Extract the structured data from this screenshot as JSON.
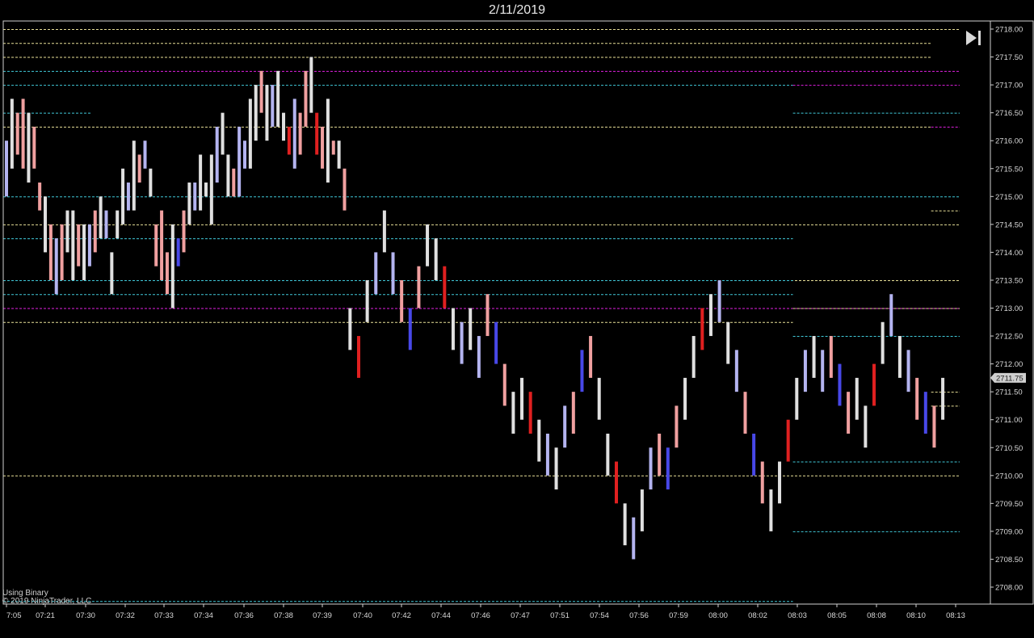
{
  "title": "2/11/2019",
  "footer": {
    "line1": "Using Binary",
    "line2": "© 2019 NinjaTrader, LLC"
  },
  "toolbar": {
    "play_end_icon": "skip-to-end-icon"
  },
  "colors": {
    "background": "#000000",
    "frame": "#cfcfcf",
    "neutral_bar": "#e0e0e0",
    "up_strong": "#4848e8",
    "up_light": "#b4b4f0",
    "down_strong": "#e02020",
    "down_light": "#f0a0a0",
    "level_yellow": "#e8e098",
    "level_cyan": "#40c8d8",
    "level_magenta": "#e020e0"
  },
  "chart_data": {
    "type": "bar",
    "ylim": [
      2707.75,
      2718.0
    ],
    "y_ticks": [
      "2718.00",
      "2717.50",
      "2717.00",
      "2716.50",
      "2716.00",
      "2715.50",
      "2715.00",
      "2714.50",
      "2714.00",
      "2713.50",
      "2713.00",
      "2712.50",
      "2712.00",
      "2711.50",
      "2711.00",
      "2710.50",
      "2710.00",
      "2709.50",
      "2709.00",
      "2708.50",
      "2708.00"
    ],
    "x_ticks": [
      "7:05",
      "07:21",
      "07:30",
      "07:32",
      "07:33",
      "07:34",
      "07:36",
      "07:38",
      "07:39",
      "07:40",
      "07:42",
      "07:44",
      "07:46",
      "07:47",
      "07:51",
      "07:54",
      "07:56",
      "07:59",
      "08:00",
      "08:02",
      "08:03",
      "08:05",
      "08:08",
      "08:10",
      "08:13"
    ],
    "current_price": "2711.75",
    "levels": [
      {
        "price": 2718.0,
        "from": 0.0,
        "to": 1.0,
        "color": "yellow"
      },
      {
        "price": 2717.75,
        "from": 0.0,
        "to": 0.94,
        "color": "yellow"
      },
      {
        "price": 2717.5,
        "from": 0.0,
        "to": 0.94,
        "color": "yellow"
      },
      {
        "price": 2717.25,
        "from": 0.0,
        "to": 0.09,
        "color": "cyan"
      },
      {
        "price": 2717.25,
        "from": 0.09,
        "to": 1.0,
        "color": "magenta"
      },
      {
        "price": 2717.0,
        "from": 0.0,
        "to": 0.8,
        "color": "cyan"
      },
      {
        "price": 2717.0,
        "from": 0.8,
        "to": 1.0,
        "color": "magenta"
      },
      {
        "price": 2716.5,
        "from": 0.0,
        "to": 0.09,
        "color": "cyan"
      },
      {
        "price": 2716.5,
        "from": 0.8,
        "to": 1.0,
        "color": "cyan"
      },
      {
        "price": 2716.25,
        "from": 0.0,
        "to": 0.94,
        "color": "yellow"
      },
      {
        "price": 2716.25,
        "from": 0.94,
        "to": 1.0,
        "color": "magenta"
      },
      {
        "price": 2715.0,
        "from": 0.0,
        "to": 1.0,
        "color": "cyan"
      },
      {
        "price": 2714.75,
        "from": 0.94,
        "to": 1.0,
        "color": "yellow"
      },
      {
        "price": 2714.5,
        "from": 0.0,
        "to": 1.0,
        "color": "yellow"
      },
      {
        "price": 2714.25,
        "from": 0.0,
        "to": 0.8,
        "color": "cyan"
      },
      {
        "price": 2713.5,
        "from": 0.0,
        "to": 1.0,
        "color": "yellow"
      },
      {
        "price": 2713.5,
        "from": 0.0,
        "to": 0.8,
        "color": "cyan"
      },
      {
        "price": 2713.25,
        "from": 0.0,
        "to": 0.8,
        "color": "cyan"
      },
      {
        "price": 2713.0,
        "from": 0.0,
        "to": 1.0,
        "color": "magenta"
      },
      {
        "price": 2713.0,
        "from": 0.8,
        "to": 1.0,
        "color": "yellow"
      },
      {
        "price": 2712.75,
        "from": 0.0,
        "to": 0.8,
        "color": "yellow"
      },
      {
        "price": 2712.5,
        "from": 0.8,
        "to": 1.0,
        "color": "cyan"
      },
      {
        "price": 2711.5,
        "from": 0.94,
        "to": 1.0,
        "color": "yellow"
      },
      {
        "price": 2711.25,
        "from": 0.94,
        "to": 1.0,
        "color": "yellow"
      },
      {
        "price": 2710.25,
        "from": 0.8,
        "to": 1.0,
        "color": "cyan"
      },
      {
        "price": 2710.0,
        "from": 0.0,
        "to": 1.0,
        "color": "yellow"
      },
      {
        "price": 2709.0,
        "from": 0.8,
        "to": 1.0,
        "color": "cyan"
      },
      {
        "price": 2707.75,
        "from": 0.0,
        "to": 0.8,
        "color": "cyan"
      }
    ],
    "bars": [
      [
        2716.0,
        2715.0,
        "L"
      ],
      [
        2716.75,
        2715.5,
        "N"
      ],
      [
        2716.5,
        2715.75,
        "d"
      ],
      [
        2716.75,
        2715.5,
        "d"
      ],
      [
        2716.5,
        2715.25,
        "N"
      ],
      [
        2716.25,
        2715.5,
        "d"
      ],
      [
        2715.25,
        2714.75,
        "d"
      ],
      [
        2715.0,
        2714.0,
        "N"
      ],
      [
        2714.5,
        2713.5,
        "d"
      ],
      [
        2714.25,
        2713.25,
        "L"
      ],
      [
        2714.5,
        2713.5,
        "d"
      ],
      [
        2714.75,
        2714.0,
        "N"
      ],
      [
        2714.75,
        2713.5,
        "N"
      ],
      [
        2714.5,
        2713.75,
        "d"
      ],
      [
        2714.5,
        2713.5,
        "N"
      ],
      [
        2714.5,
        2713.75,
        "L"
      ],
      [
        2714.75,
        2714.0,
        "d"
      ],
      [
        2715.0,
        2714.25,
        "N"
      ],
      [
        2714.75,
        2714.25,
        "L"
      ],
      [
        2714.0,
        2713.25,
        "N"
      ],
      [
        2714.75,
        2714.25,
        "N"
      ],
      [
        2715.5,
        2714.5,
        "N"
      ],
      [
        2715.25,
        2714.75,
        "L"
      ],
      [
        2716.0,
        2714.75,
        "N"
      ],
      [
        2715.75,
        2715.25,
        "d"
      ],
      [
        2716.0,
        2715.5,
        "L"
      ],
      [
        2715.5,
        2715.0,
        "N"
      ],
      [
        2714.5,
        2713.75,
        "d"
      ],
      [
        2714.75,
        2713.5,
        "d"
      ],
      [
        2714.0,
        2713.25,
        "d"
      ],
      [
        2714.5,
        2713.0,
        "N"
      ],
      [
        2714.25,
        2713.75,
        "U"
      ],
      [
        2714.75,
        2714.0,
        "d"
      ],
      [
        2715.25,
        2714.5,
        "N"
      ],
      [
        2715.25,
        2714.75,
        "L"
      ],
      [
        2715.75,
        2714.75,
        "N"
      ],
      [
        2715.25,
        2715.0,
        "N"
      ],
      [
        2715.75,
        2714.5,
        "N"
      ],
      [
        2716.25,
        2715.25,
        "L"
      ],
      [
        2716.5,
        2715.75,
        "N"
      ],
      [
        2715.75,
        2715.0,
        "N"
      ],
      [
        2715.5,
        2715.0,
        "d"
      ],
      [
        2716.25,
        2715.0,
        "L"
      ],
      [
        2716.0,
        2715.5,
        "L"
      ],
      [
        2716.75,
        2715.5,
        "N"
      ],
      [
        2717.0,
        2716.0,
        "N"
      ],
      [
        2717.25,
        2716.5,
        "d"
      ],
      [
        2717.0,
        2716.0,
        "N"
      ],
      [
        2717.0,
        2716.25,
        "L"
      ],
      [
        2717.25,
        2716.25,
        "N"
      ],
      [
        2716.5,
        2716.0,
        "N"
      ],
      [
        2716.25,
        2715.75,
        "D"
      ],
      [
        2716.75,
        2715.5,
        "L"
      ],
      [
        2716.5,
        2715.75,
        "d"
      ],
      [
        2717.25,
        2716.25,
        "d"
      ],
      [
        2717.5,
        2716.5,
        "N"
      ],
      [
        2716.5,
        2715.75,
        "D"
      ],
      [
        2716.25,
        2715.5,
        "d"
      ],
      [
        2716.75,
        2715.25,
        "N"
      ],
      [
        2716.0,
        2715.75,
        "d"
      ],
      [
        2716.0,
        2715.5,
        "N"
      ],
      [
        2715.5,
        2714.75,
        "d"
      ]
    ]
  }
}
